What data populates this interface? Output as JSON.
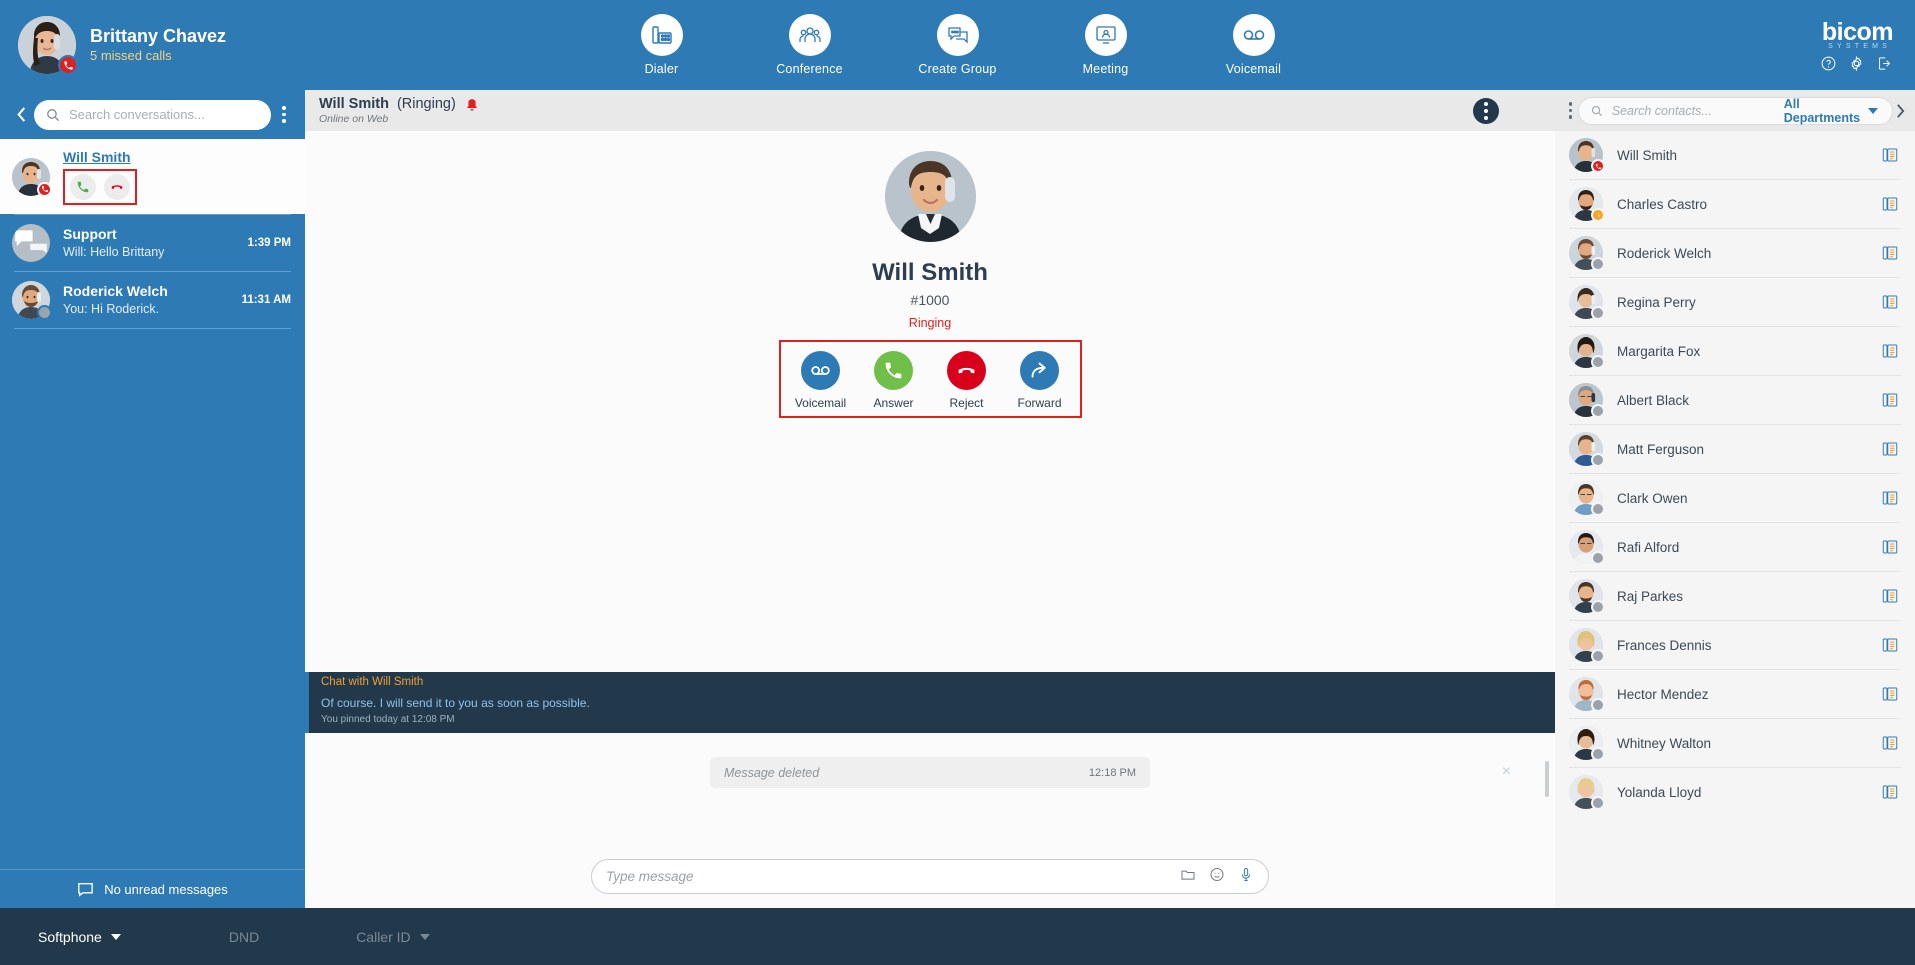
{
  "topbar": {
    "user": {
      "name": "Brittany Chavez",
      "status": "5 missed calls",
      "presence": "on-call"
    },
    "nav": [
      {
        "label": "Dialer",
        "icon": "dialpad-phone-icon"
      },
      {
        "label": "Conference",
        "icon": "group-people-icon"
      },
      {
        "label": "Create Group",
        "icon": "chat-bubbles-icon"
      },
      {
        "label": "Meeting",
        "icon": "presentation-person-icon"
      },
      {
        "label": "Voicemail",
        "icon": "voicemail-icon"
      }
    ],
    "brand": {
      "name": "bicom",
      "tagline": "SYSTEMS"
    },
    "brand_icons": [
      "help-icon",
      "gear-icon",
      "logout-icon"
    ]
  },
  "conversations": {
    "search_placeholder": "Search conversations...",
    "search_value": "",
    "items": [
      {
        "name": "Will Smith",
        "preview": "",
        "time": "",
        "active": true,
        "presence": "ringing",
        "call_controls": [
          {
            "name": "answer-call-button",
            "label": "Answer"
          },
          {
            "name": "reject-call-button",
            "label": "Reject"
          }
        ]
      },
      {
        "name": "Support",
        "preview": "Will: Hello Brittany",
        "time": "1:39 PM",
        "active": false,
        "presence": "group"
      },
      {
        "name": "Roderick Welch",
        "preview": "You: Hi Roderick.",
        "time": "11:31 AM",
        "active": false,
        "presence": "offline"
      }
    ],
    "footer": "No unread messages"
  },
  "call": {
    "header_name": "Will Smith",
    "header_state": "(Ringing)",
    "header_sub": "Online on Web",
    "name": "Will Smith",
    "extension": "#1000",
    "status": "Ringing",
    "status_color": "#e02020",
    "actions": [
      {
        "label": "Voicemail",
        "icon": "voicemail-icon",
        "color": "#2e7ab5"
      },
      {
        "label": "Answer",
        "icon": "phone-icon",
        "color": "#6fbf48"
      },
      {
        "label": "Reject",
        "icon": "phone-hangup-icon",
        "color": "#d9001b"
      },
      {
        "label": "Forward",
        "icon": "forward-arrow-icon",
        "color": "#2e7ab5"
      }
    ]
  },
  "chat": {
    "pinned_title": "Chat with Will Smith",
    "pinned_message": "Of course. I will send it to you as soon as possible.",
    "pinned_meta": "You pinned today at 12:08 PM",
    "close_label": "×",
    "messages": [
      {
        "text": "Message deleted",
        "time": "12:18 PM",
        "deleted": true
      }
    ],
    "composer_placeholder": "Type message",
    "composer_value": "",
    "composer_icons": [
      "attach-folder-icon",
      "emoji-icon",
      "microphone-icon"
    ]
  },
  "contacts": {
    "search_placeholder": "Search contacts...",
    "search_value": "",
    "department": "All Departments",
    "items": [
      {
        "name": "Will Smith",
        "presence": "ringing"
      },
      {
        "name": "Charles Castro",
        "presence": "away"
      },
      {
        "name": "Roderick Welch",
        "presence": "offline"
      },
      {
        "name": "Regina Perry",
        "presence": "offline"
      },
      {
        "name": "Margarita Fox",
        "presence": "offline"
      },
      {
        "name": "Albert Black",
        "presence": "offline"
      },
      {
        "name": "Matt Ferguson",
        "presence": "offline"
      },
      {
        "name": "Clark Owen",
        "presence": "offline"
      },
      {
        "name": "Rafi Alford",
        "presence": "offline"
      },
      {
        "name": "Raj Parkes",
        "presence": "offline"
      },
      {
        "name": "Frances Dennis",
        "presence": "offline"
      },
      {
        "name": "Hector Mendez",
        "presence": "offline"
      },
      {
        "name": "Whitney Walton",
        "presence": "offline"
      },
      {
        "name": "Yolanda Lloyd",
        "presence": "offline"
      }
    ]
  },
  "bottombar": {
    "softphone": "Softphone",
    "dnd": "DND",
    "caller_id": "Caller ID"
  }
}
